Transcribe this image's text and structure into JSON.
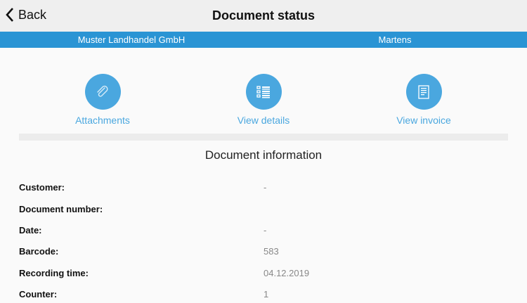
{
  "nav": {
    "back_label": "Back",
    "title": "Document status"
  },
  "info_bar": {
    "company": "Muster Landhandel GmbH",
    "user": "Martens"
  },
  "actions": [
    {
      "label": "Attachments",
      "icon": "paperclip-icon"
    },
    {
      "label": "View details",
      "icon": "list-icon"
    },
    {
      "label": "View invoice",
      "icon": "invoice-icon"
    }
  ],
  "section_title": "Document information",
  "fields": [
    {
      "label": "Customer:",
      "value": "-"
    },
    {
      "label": "Document number:",
      "value": ""
    },
    {
      "label": "Date:",
      "value": "-"
    },
    {
      "label": "Barcode:",
      "value": "583"
    },
    {
      "label": "Recording time:",
      "value": "04.12.2019"
    },
    {
      "label": "Counter:",
      "value": "1"
    }
  ],
  "colors": {
    "accent": "#4aa7df",
    "bar": "#2a94d4"
  }
}
